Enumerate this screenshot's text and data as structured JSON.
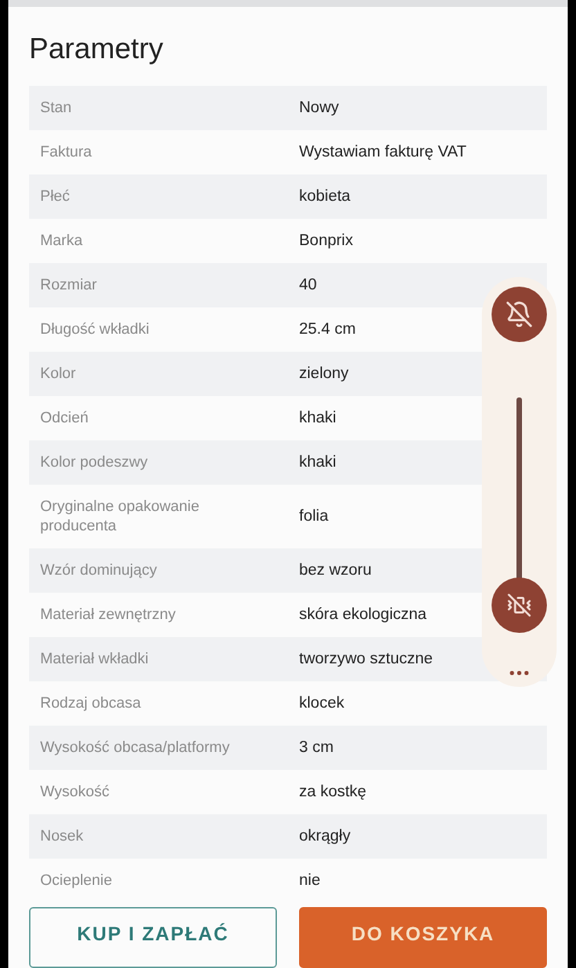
{
  "title": "Parametry",
  "parameters": [
    {
      "label": "Stan",
      "value": "Nowy"
    },
    {
      "label": "Faktura",
      "value": "Wystawiam fakturę VAT"
    },
    {
      "label": "Płeć",
      "value": "kobieta"
    },
    {
      "label": "Marka",
      "value": "Bonprix"
    },
    {
      "label": "Rozmiar",
      "value": "40"
    },
    {
      "label": "Długość wkładki",
      "value": "25.4 cm"
    },
    {
      "label": "Kolor",
      "value": "zielony"
    },
    {
      "label": "Odcień",
      "value": "khaki"
    },
    {
      "label": "Kolor podeszwy",
      "value": "khaki"
    },
    {
      "label": "Oryginalne opakowanie producenta",
      "value": "folia"
    },
    {
      "label": "Wzór dominujący",
      "value": "bez wzoru"
    },
    {
      "label": "Materiał zewnętrzny",
      "value": "skóra ekologiczna"
    },
    {
      "label": "Materiał wkładki",
      "value": "tworzywo sztuczne"
    },
    {
      "label": "Rodzaj obcasa",
      "value": "klocek"
    },
    {
      "label": "Wysokość obcasa/platformy",
      "value": "3 cm"
    },
    {
      "label": "Wysokość",
      "value": "za kostkę"
    },
    {
      "label": "Nosek",
      "value": "okrągły"
    },
    {
      "label": "Ocieplenie",
      "value": "nie"
    }
  ],
  "buttons": [
    {
      "label": "KUP I ZAPŁAĆ",
      "kind": "outline"
    },
    {
      "label": "DO KOSZYKA",
      "kind": "filled"
    }
  ],
  "volume_panel": {
    "level": 0
  }
}
